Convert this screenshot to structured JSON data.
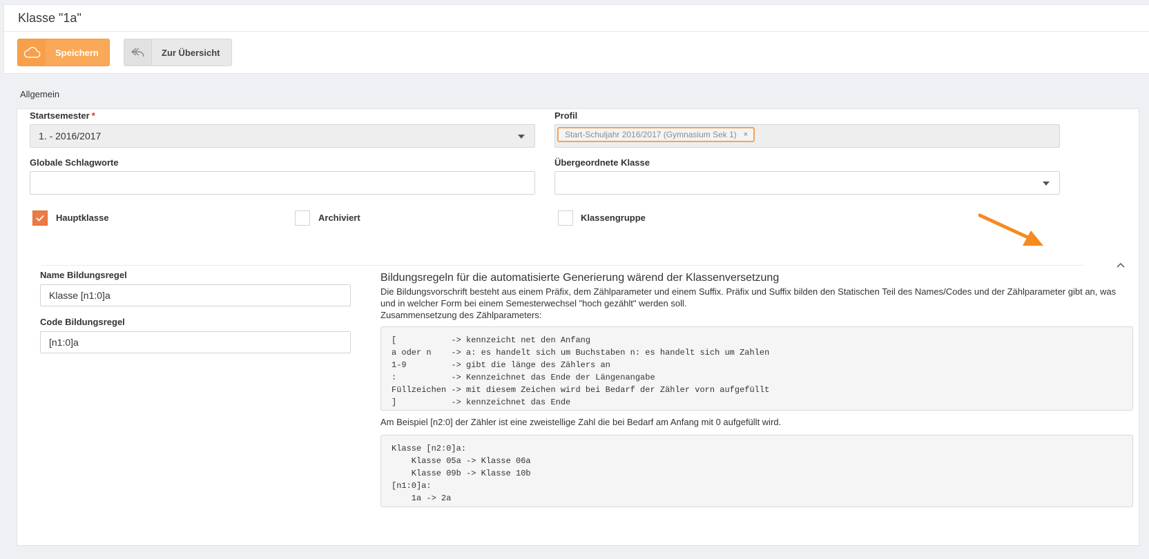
{
  "header": {
    "title": "Klasse \"1a\"",
    "save_label": "Speichern",
    "back_label": "Zur Übersicht"
  },
  "section": {
    "label": "Allgemein"
  },
  "form": {
    "startsemester": {
      "label": "Startsemester",
      "required_mark": "*",
      "value": "1. - 2016/2017"
    },
    "profil": {
      "label": "Profil",
      "tag": "Start-Schuljahr 2016/2017 (Gymnasium Sek 1)",
      "tag_remove": "×"
    },
    "schlagworte": {
      "label": "Globale Schlagworte",
      "value": ""
    },
    "uebergeordnet": {
      "label": "Übergeordnete Klasse",
      "value": ""
    },
    "checkboxes": [
      {
        "label": "Hauptklasse",
        "checked": true
      },
      {
        "label": "Archiviert",
        "checked": false
      },
      {
        "label": "Klassengruppe",
        "checked": false
      }
    ],
    "name_rule": {
      "label": "Name Bildungsregel",
      "value": "Klasse [n1:0]a"
    },
    "code_rule": {
      "label": "Code Bildungsregel",
      "value": "[n1:0]a"
    }
  },
  "rules": {
    "title": "Bildungsregeln für die automatisierte Generierung wärend der Klassenversetzung",
    "desc1": "Die Bildungsvorschrift besteht aus einem Präfix, dem Zählparameter und einem Suffix. Präfix und Suffix bilden den Statischen Teil des Names/Codes und der Zählparameter gibt an, was und in welcher Form bei einem Semesterwechsel \"hoch gezählt\" werden soll.",
    "desc2": "Zusammensetzung des Zählparameters:",
    "code1": "[           -> kennzeicht net den Anfang\na oder n    -> a: es handelt sich um Buchstaben n: es handelt sich um Zahlen\n1-9         -> gibt die länge des Zählers an\n:           -> Kennzeichnet das Ende der Längenangabe\nFüllzeichen -> mit diesem Zeichen wird bei Bedarf der Zähler vorn aufgefüllt\n]           -> kennzeichnet das Ende",
    "example": "Am Beispiel [n2:0] der Zähler ist eine zweistellige Zahl die bei Bedarf am Anfang mit 0 aufgefüllt wird.",
    "code2": "Klasse [n2:0]a:\n    Klasse 05a -> Klasse 06a\n    Klasse 09b -> Klasse 10b\n[n1:0]a:\n    1a -> 2a"
  },
  "colors": {
    "accent": "#f9a957",
    "checkbox_checked": "#ec7a45",
    "annotation_arrow": "#f68a1e"
  },
  "icons": {
    "save": "cloud-icon",
    "back": "reply-arrow-icon",
    "collapse": "chevron-up-icon",
    "select": "caret-down-icon",
    "check": "checkmark-icon"
  }
}
